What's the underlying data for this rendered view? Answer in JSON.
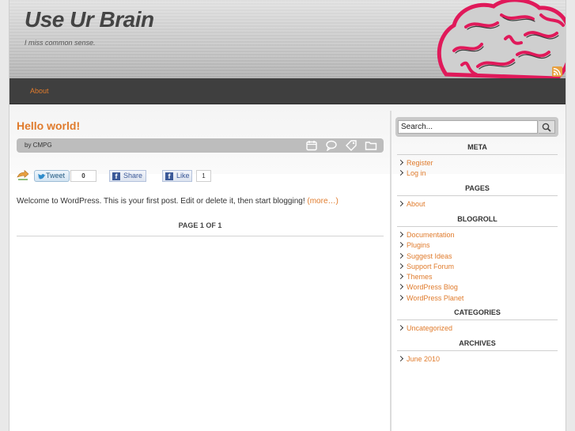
{
  "site": {
    "title": "Use Ur Brain",
    "description": "I miss common sense."
  },
  "nav": {
    "items": [
      {
        "label": "About"
      }
    ]
  },
  "post": {
    "title": "Hello world!",
    "author_line": "by CMPG",
    "share": {
      "tweet_label": "Tweet",
      "tweet_count": "0",
      "fb_share_label": "Share",
      "fb_like_label": "Like",
      "fb_like_count": "1"
    },
    "excerpt": "Welcome to WordPress. This is your first post. Edit or delete it, then start blogging!",
    "more_link": "(more…)"
  },
  "pagination": "PAGE 1 OF 1",
  "sidebar": {
    "search_value": "Search...",
    "widgets": [
      {
        "title": "META",
        "items": [
          "Register",
          "Log in"
        ]
      },
      {
        "title": "PAGES",
        "items": [
          "About"
        ]
      },
      {
        "title": "BLOGROLL",
        "items": [
          "Documentation",
          "Plugins",
          "Suggest Ideas",
          "Support Forum",
          "Themes",
          "WordPress Blog",
          "WordPress Planet"
        ]
      },
      {
        "title": "CATEGORIES",
        "items": [
          "Uncategorized"
        ]
      },
      {
        "title": "ARCHIVES",
        "items": [
          "June 2010"
        ]
      }
    ]
  },
  "colors": {
    "accent": "#e07b2c",
    "nav_bg": "#3f3f3f",
    "brain_outline": "#e0195a"
  }
}
